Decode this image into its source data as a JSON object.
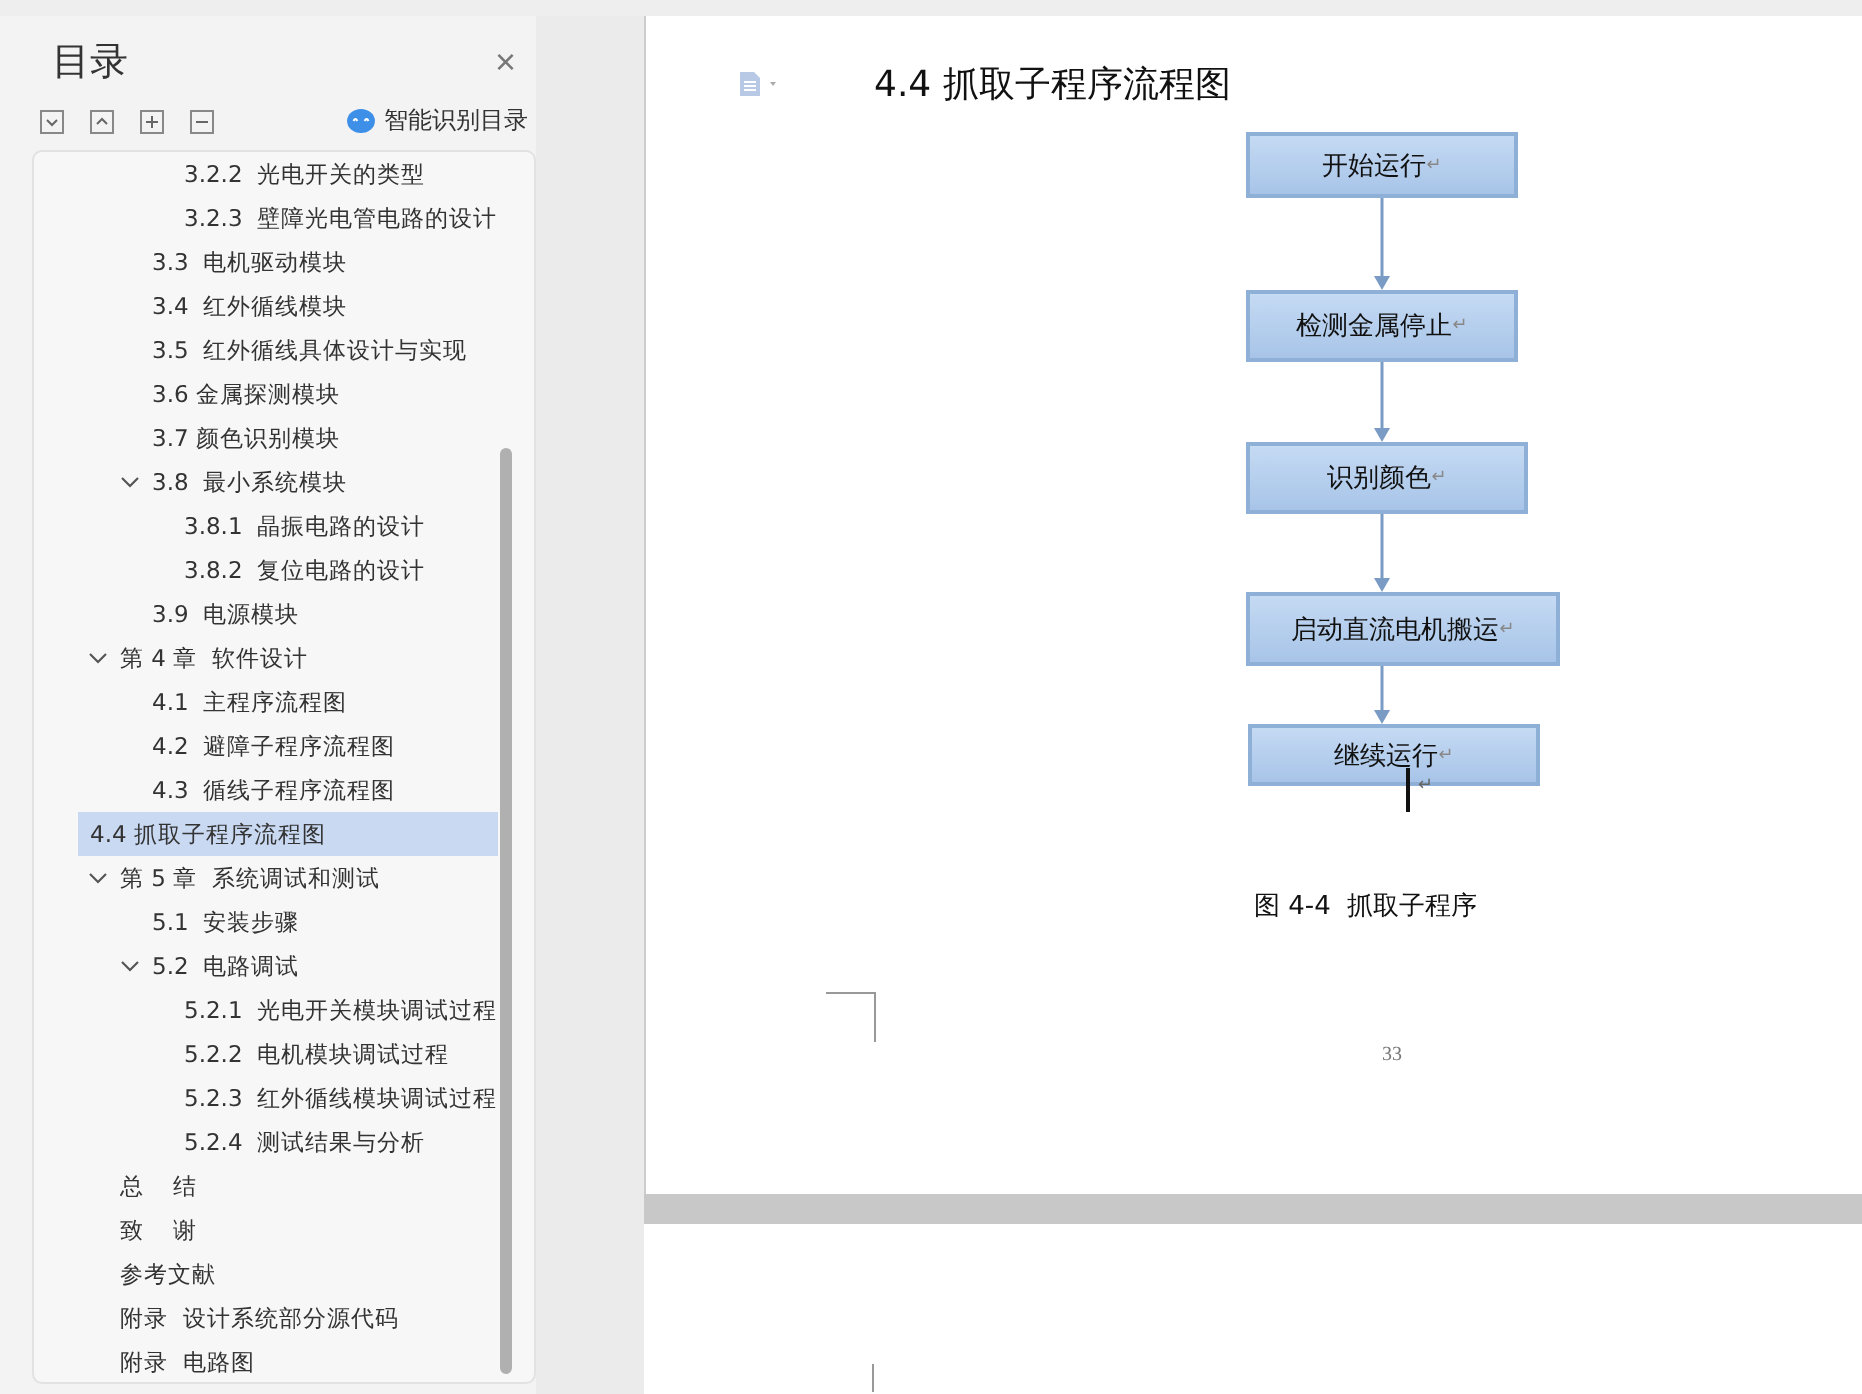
{
  "sidebar": {
    "title": "目录",
    "close": "×",
    "smart_toc": "智能识别目录",
    "toc": [
      {
        "children": [
          {
            "children": [
              {
                "label": "3.2.2  光电开关的类型",
                "selected": false
              },
              {
                "label": "3.2.3  壁障光电管电路的设计",
                "selected": false
              }
            ]
          },
          {
            "label": "3.3  电机驱动模块",
            "selected": false
          },
          {
            "label": "3.4  红外循线模块",
            "selected": false
          },
          {
            "label": "3.5  红外循线具体设计与实现",
            "selected": false
          },
          {
            "label": "3.6 金属探测模块",
            "selected": false
          },
          {
            "label": "3.7 颜色识别模块",
            "selected": false
          },
          {
            "label": "3.8  最小系统模块",
            "selected": false,
            "expanded": true,
            "children": [
              {
                "label": "3.8.1  晶振电路的设计",
                "selected": false
              },
              {
                "label": "3.8.2  复位电路的设计",
                "selected": false
              }
            ]
          },
          {
            "label": "3.9  电源模块",
            "selected": false
          }
        ]
      },
      {
        "label": "第 4 章  软件设计",
        "selected": false,
        "expanded": true,
        "children": [
          {
            "label": "4.1  主程序流程图",
            "selected": false
          },
          {
            "label": "4.2  避障子程序流程图",
            "selected": false
          },
          {
            "label": "4.3  循线子程序流程图",
            "selected": false
          },
          {
            "label": "4.4 抓取子程序流程图",
            "selected": true
          }
        ]
      },
      {
        "label": "第 5 章  系统调试和测试",
        "selected": false,
        "expanded": true,
        "children": [
          {
            "label": "5.1  安装步骤",
            "selected": false
          },
          {
            "label": "5.2  电路调试",
            "selected": false,
            "expanded": true,
            "children": [
              {
                "label": "5.2.1  光电开关模块调试过程",
                "selected": false
              },
              {
                "label": "5.2.2  电机模块调试过程",
                "selected": false
              },
              {
                "label": "5.2.3  红外循线模块调试过程",
                "selected": false
              },
              {
                "label": "5.2.4  测试结果与分析",
                "selected": false
              }
            ]
          }
        ]
      },
      {
        "label": "总    结",
        "selected": false
      },
      {
        "label": "致    谢",
        "selected": false
      },
      {
        "label": "参考文献",
        "selected": false
      },
      {
        "label": "附录  设计系统部分源代码",
        "selected": false
      },
      {
        "label": "附录  电路图",
        "selected": false
      }
    ]
  },
  "document": {
    "heading": "4.4 抓取子程序流程图",
    "flowchart": [
      {
        "label": "开始运行",
        "mark": "↵"
      },
      {
        "label": "检测金属停止",
        "mark": "↵"
      },
      {
        "label": "识别颜色",
        "mark": "↵"
      },
      {
        "label": "启动直流电机搬运",
        "mark": "↵"
      },
      {
        "label": "继续运行",
        "mark": "↵"
      }
    ],
    "after_mark": "↵",
    "caption_number": "图 4-4",
    "caption_text": "抓取子程序",
    "page_number": "33"
  }
}
